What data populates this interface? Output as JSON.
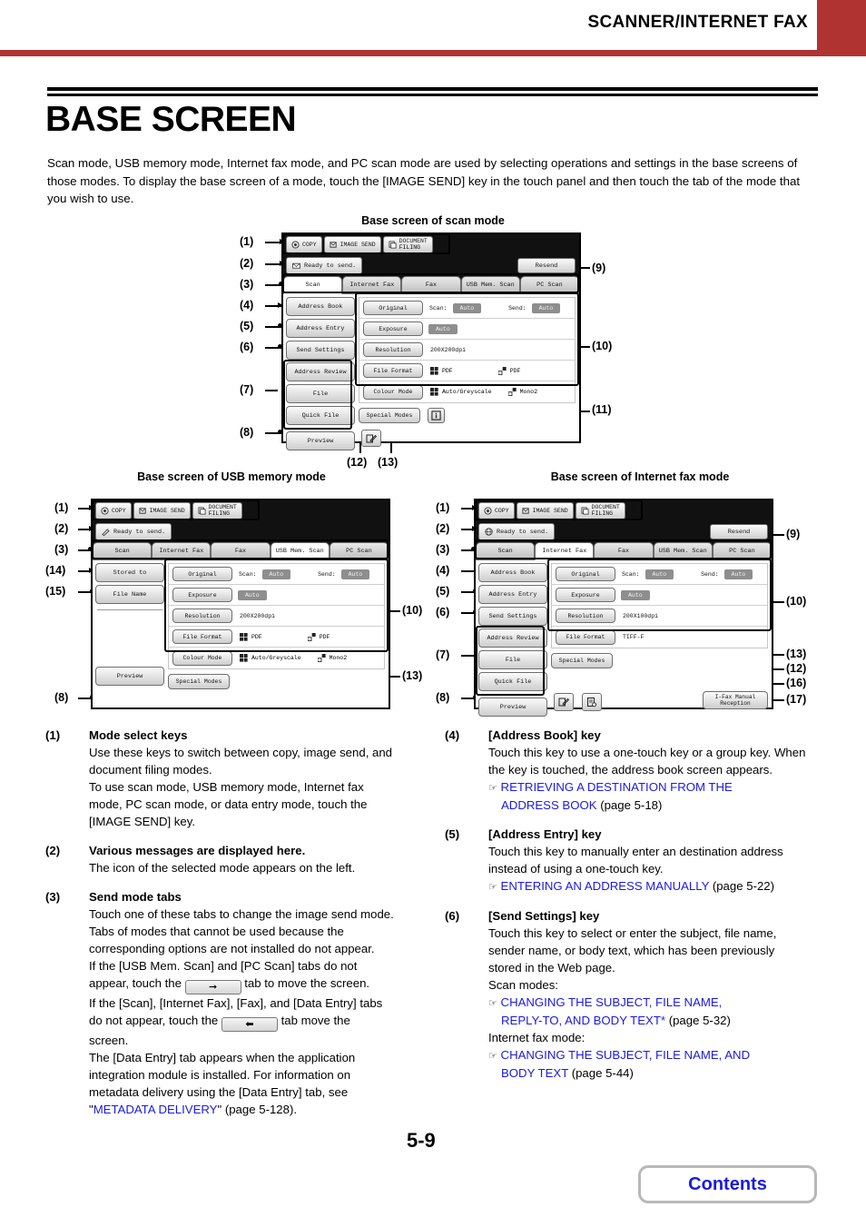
{
  "header": {
    "title": "SCANNER/INTERNET FAX",
    "accent": "#b03332"
  },
  "page": {
    "title": "BASE SCREEN",
    "intro": "Scan mode, USB memory mode, Internet fax mode, and PC scan mode are used by selecting operations and settings in the base screens of those modes. To display the base screen of a mode, touch the [IMAGE SEND] key in the touch panel and then touch the tab of the mode that you wish to use.",
    "number": "5-9",
    "contents_label": "Contents"
  },
  "figures": {
    "scan_caption": "Base screen of scan mode",
    "usb_caption": "Base screen of USB memory mode",
    "ifax_caption": "Base screen of Internet fax mode"
  },
  "device": {
    "mode_keys": [
      {
        "label": "COPY",
        "icon": "copy-icon"
      },
      {
        "label": "IMAGE SEND",
        "icon": "image-send-icon"
      },
      {
        "label_line1": "DOCUMENT",
        "label_line2": "FILING",
        "icon": "document-filing-icon"
      }
    ],
    "status_message": "Ready to send.",
    "resend_label": "Resend",
    "tabs": [
      "Scan",
      "Internet Fax",
      "Fax",
      "USB Mem. Scan",
      "PC Scan"
    ],
    "special_modes_label": "Special Modes",
    "preview_label": "Preview",
    "ifax_manual_line1": "I-Fax Manual",
    "ifax_manual_line2": "Reception"
  },
  "scan_screen": {
    "active_tab": "Scan",
    "left_buttons": [
      "Address Book",
      "Address Entry",
      "Send Settings",
      "Address Review",
      "File",
      "Quick File"
    ],
    "settings": [
      {
        "key": "Original",
        "label1": "Scan:",
        "value1": "Auto",
        "label2": "Send:",
        "value2": "Auto"
      },
      {
        "key": "Exposure",
        "value1": "Auto"
      },
      {
        "key": "Resolution",
        "plain": "200X200dpi"
      },
      {
        "key": "File Format",
        "fmt1": "PDF",
        "fmt2": "PDF"
      },
      {
        "key": "Colour Mode",
        "fmt1": "Auto/Greyscale",
        "fmt2": "Mono2"
      }
    ]
  },
  "usb_screen": {
    "active_tab": "USB Mem. Scan",
    "left_buttons": [
      "Stored to",
      "File Name"
    ],
    "settings": [
      {
        "key": "Original",
        "label1": "Scan:",
        "value1": "Auto",
        "label2": "Send:",
        "value2": "Auto"
      },
      {
        "key": "Exposure",
        "value1": "Auto"
      },
      {
        "key": "Resolution",
        "plain": "200X200dpi"
      },
      {
        "key": "File Format",
        "fmt1": "PDF",
        "fmt2": "PDF"
      },
      {
        "key": "Colour Mode",
        "fmt1": "Auto/Greyscale",
        "fmt2": "Mono2"
      }
    ]
  },
  "ifax_screen": {
    "active_tab": "Internet Fax",
    "left_buttons": [
      "Address Book",
      "Address Entry",
      "Send Settings",
      "Address Review",
      "File",
      "Quick File"
    ],
    "settings": [
      {
        "key": "Original",
        "label1": "Scan:",
        "value1": "Auto",
        "label2": "Send:",
        "value2": "Auto"
      },
      {
        "key": "Exposure",
        "value1": "Auto"
      },
      {
        "key": "Resolution",
        "plain": "200X100dpi"
      },
      {
        "key": "File Format",
        "plain": "TIFF-F"
      }
    ]
  },
  "callouts": {
    "scan": [
      "(1)",
      "(2)",
      "(3)",
      "(4)",
      "(5)",
      "(6)",
      "(7)",
      "(8)",
      "(9)",
      "(10)",
      "(11)",
      "(12)",
      "(13)"
    ],
    "usb": [
      "(1)",
      "(2)",
      "(3)",
      "(14)",
      "(15)",
      "(8)",
      "(10)",
      "(13)"
    ],
    "ifax": [
      "(1)",
      "(2)",
      "(3)",
      "(4)",
      "(5)",
      "(6)",
      "(7)",
      "(8)",
      "(9)",
      "(10)",
      "(13)",
      "(12)",
      "(16)",
      "(17)"
    ]
  },
  "items_left": [
    {
      "num": "(1)",
      "head": "Mode select keys",
      "lines": [
        "Use these keys to switch between copy, image send, and",
        "document filing modes.",
        "To use scan mode, USB memory mode, Internet fax",
        "mode, PC scan mode, or data entry mode, touch the",
        "[IMAGE SEND] key."
      ]
    },
    {
      "num": "(2)",
      "head": "Various messages are displayed here.",
      "lines": [
        "The icon of the selected mode appears on the left."
      ]
    },
    {
      "num": "(3)",
      "head": "Send mode tabs",
      "lines": [
        "Touch one of these tabs to change the image send mode.",
        "Tabs of modes that cannot be used because the",
        "corresponding options are not installed do not appear."
      ],
      "seg_a_pre": "If the [USB Mem. Scan] and [PC Scan] tabs do not",
      "seg_a_mid1": "appear, touch the",
      "seg_a_mid2": "tab to move the screen.",
      "seg_b_pre": "If the [Scan], [Internet Fax], [Fax], and [Data Entry] tabs",
      "seg_b_mid1": "do not appear, touch the",
      "seg_b_mid2": "tab move the",
      "seg_b_end": "screen.",
      "tail": [
        "The [Data Entry] tab appears when the application",
        "integration module is installed. For information on",
        "metadata delivery using the [Data Entry] tab, see"
      ],
      "tail_link": "METADATA DELIVERY",
      "tail_after": " (page 5-128)."
    }
  ],
  "items_right": [
    {
      "num": "(4)",
      "head": "[Address Book] key",
      "lines": [
        "Touch this key to use a one-touch key or a group key. When",
        "the key is touched, the address book screen appears."
      ],
      "refs": [
        {
          "line1": "RETRIEVING A DESTINATION FROM THE",
          "line2": "ADDRESS BOOK",
          "after": " (page 5-18)"
        }
      ]
    },
    {
      "num": "(5)",
      "head": "[Address Entry] key",
      "lines": [
        "Touch this key to manually enter an destination address",
        "instead of using a one-touch key."
      ],
      "refs": [
        {
          "line1": "ENTERING AN ADDRESS MANUALLY",
          "after": " (page 5-22)"
        }
      ]
    },
    {
      "num": "(6)",
      "head": "[Send Settings] key",
      "lines": [
        "Touch this key to select or enter the subject, file name,",
        "sender name, or body text, which has been previously",
        "stored in the Web page.",
        "Scan modes:"
      ],
      "refs": [
        {
          "line1": "CHANGING THE SUBJECT, FILE NAME,",
          "line2": "REPLY-TO, AND BODY TEXT*",
          "after": " (page 5-32)"
        }
      ],
      "mid": "Internet fax mode:",
      "refs2": [
        {
          "line1": "CHANGING THE SUBJECT, FILE NAME, AND",
          "line2": "BODY TEXT",
          "after": " (page 5-44)"
        }
      ]
    }
  ]
}
